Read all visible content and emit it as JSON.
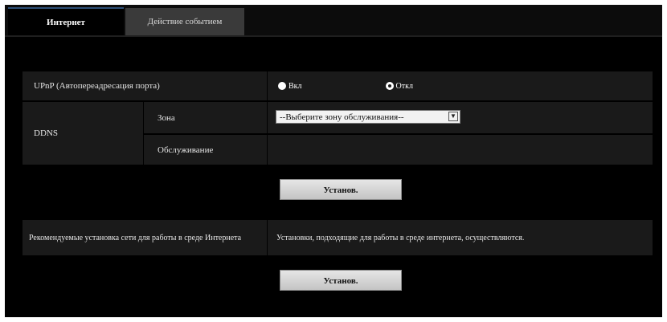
{
  "tabs": [
    {
      "label": "Интернет",
      "active": true
    },
    {
      "label": "Действие событием",
      "active": false
    }
  ],
  "upnp": {
    "label": "UPnP (Автопереадресация порта)",
    "options": [
      {
        "label": "Вкл",
        "checked": true
      },
      {
        "label": "Откл",
        "checked": false
      }
    ]
  },
  "ddns": {
    "label": "DDNS",
    "zone_label": "Зона",
    "zone_select_value": "--Выберите зону обслуживания--",
    "service_label": "Обслуживание",
    "service_value": ""
  },
  "apply_button_1": "Установ.",
  "recommended": {
    "label": "Рекомендуемые установка сети для работы в среде Интернета",
    "description": "Установки, подходящие для работы в среде интернета, осуществляются."
  },
  "apply_button_2": "Установ.",
  "colors": {
    "background": "#000000",
    "row_background": "#1a1a1a",
    "tab_inactive": "#3a3a3a",
    "tab_active_accent": "#2d4f77",
    "button": "#d4d4d4"
  },
  "icons": {
    "select_arrow": "chevron-down-icon",
    "radio_checked": "radio-checked-icon",
    "radio_unchecked": "radio-unchecked-icon"
  }
}
